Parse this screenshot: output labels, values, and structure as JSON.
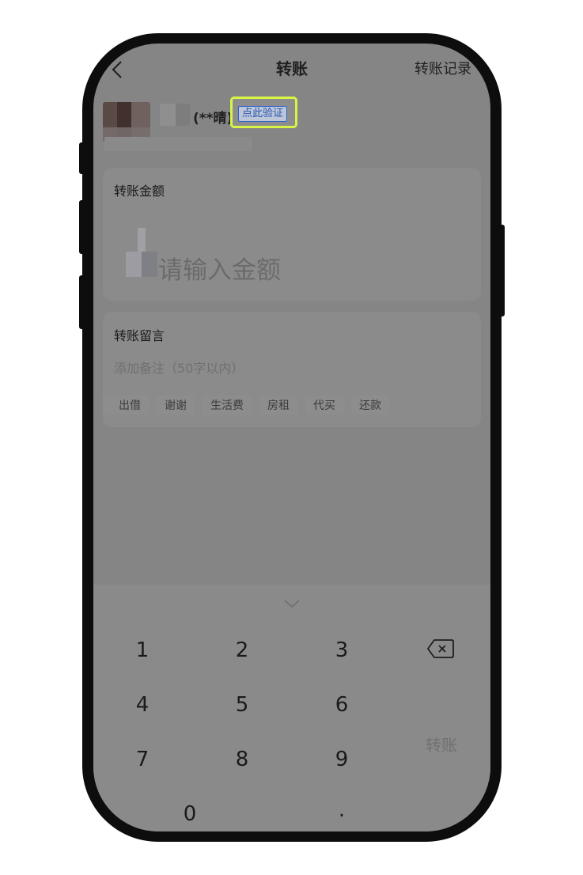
{
  "header": {
    "title": "转账",
    "record_link": "转账记录"
  },
  "recipient": {
    "name_masked": "(**晴)",
    "verify_label": "点此验证"
  },
  "amount_card": {
    "label": "转账金额",
    "placeholder": "请输入金额"
  },
  "note_card": {
    "label": "转账留言",
    "placeholder": "添加备注（50字以内）",
    "tags": [
      "出借",
      "谢谢",
      "生活费",
      "房租",
      "代买",
      "还款"
    ]
  },
  "keypad": {
    "keys": [
      "1",
      "2",
      "3",
      "4",
      "5",
      "6",
      "7",
      "8",
      "9",
      "0",
      "."
    ],
    "transfer_label": "转账"
  },
  "icons": {
    "back": "chevron-left-icon",
    "collapse": "chevron-down-icon",
    "delete": "backspace-icon"
  },
  "colors": {
    "highlight": "#d6f545",
    "verify_text": "#2a54b5",
    "overlay_background": "#858585"
  }
}
